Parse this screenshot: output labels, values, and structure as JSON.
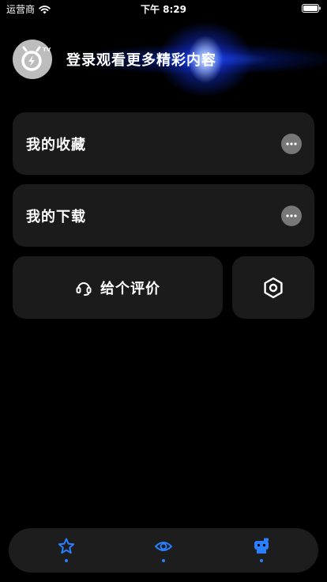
{
  "status_bar": {
    "carrier": "运营商",
    "time": "下午 8:29"
  },
  "header": {
    "avatar_icon": "tv-icon",
    "login_prompt": "登录观看更多精彩内容"
  },
  "menu": {
    "favorites_label": "我的收藏",
    "downloads_label": "我的下载",
    "rate_label": "给个评价"
  },
  "tab_bar": {
    "tabs": [
      "star-icon",
      "eye-icon",
      "robot-icon"
    ]
  },
  "colors": {
    "background": "#000000",
    "card": "#1b1b1b",
    "accent": "#2a7fff",
    "glow": "#1e50ff"
  }
}
